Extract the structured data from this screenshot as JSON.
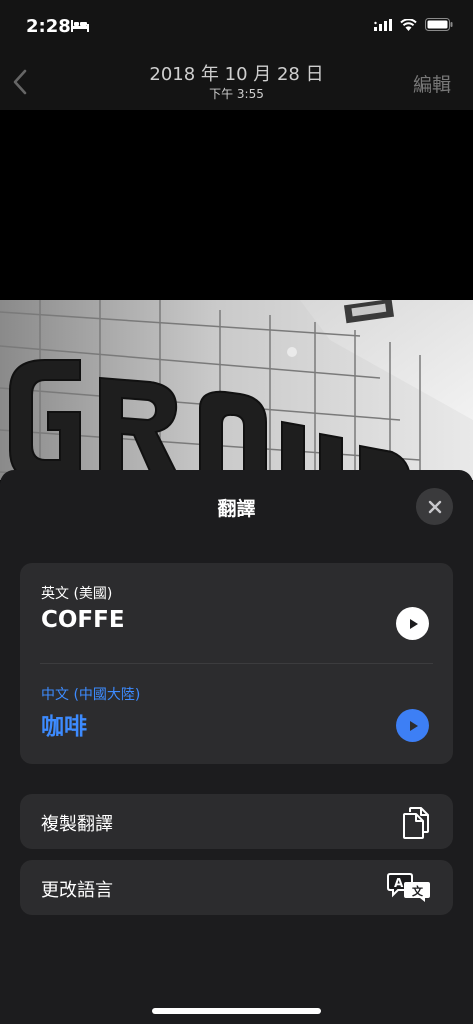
{
  "status_bar": {
    "time": "2:28"
  },
  "nav": {
    "title": "2018 年 10 月 28 日",
    "subtitle": "下午 3:55",
    "edit_label": "編輯"
  },
  "sheet": {
    "title": "翻譯",
    "source": {
      "language": "英文 (美國)",
      "text": "COFFE"
    },
    "target": {
      "language": "中文 (中國大陸)",
      "text": "咖啡"
    },
    "actions": [
      {
        "label": "複製翻譯",
        "icon": "copy-icon"
      },
      {
        "label": "更改語言",
        "icon": "translate-icon"
      }
    ]
  },
  "colors": {
    "accent": "#3d7ff5",
    "sheet_bg": "#1c1c1e",
    "card_bg": "#2c2c2e"
  }
}
